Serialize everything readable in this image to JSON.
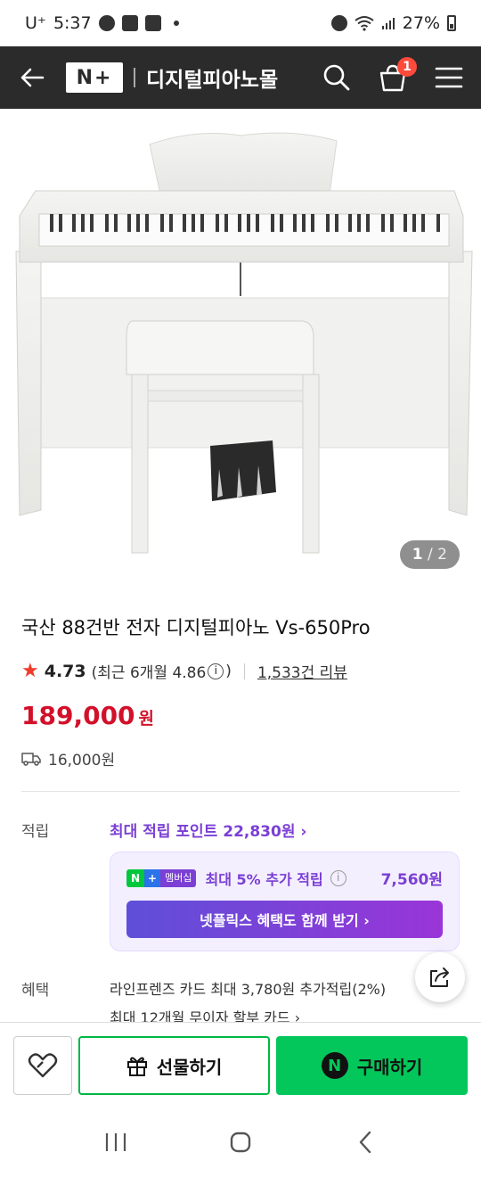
{
  "status_bar": {
    "carrier": "U⁺",
    "time": "5:37",
    "battery": "27%"
  },
  "header": {
    "logo_text": "N+",
    "store_name": "디지털피아노몰",
    "cart_count": "1"
  },
  "gallery": {
    "current": "1",
    "separator": "/",
    "total": "2"
  },
  "product": {
    "title": "국산 88건반 전자 디지털피아노 Vs-650Pro",
    "rating": "4.73",
    "recent_rating_open": "(최근 6개월 4.86",
    "info_symbol": "i",
    "recent_rating_close": ")",
    "review_count": "1,533건 리뷰",
    "price": "189,000",
    "currency": "원",
    "shipping_fee": "16,000원"
  },
  "points": {
    "label": "적립",
    "max_points": "최대 적립 포인트 22,830원 ›",
    "membership": {
      "badge_n": "N",
      "badge_plus": "+",
      "badge_text": "멤버십",
      "text": "최대 5% 추가 적립",
      "info_symbol": "i",
      "amount": "7,560원",
      "netflix_button": "넷플릭스 혜택도 함께 받기 ›"
    }
  },
  "benefits": {
    "label": "혜택",
    "line1": "라인프렌즈 카드 최대 3,780원 추가적립(2%)",
    "line2": "최대 12개월 무이자 할부 카드 ›"
  },
  "actions": {
    "gift_label": "선물하기",
    "buy_label": "구매하기",
    "buy_badge": "N"
  },
  "colors": {
    "price": "#d3102a",
    "membership": "#7b3fd4",
    "buy_green": "#03c75a",
    "header_bg": "#2b2b2b"
  }
}
